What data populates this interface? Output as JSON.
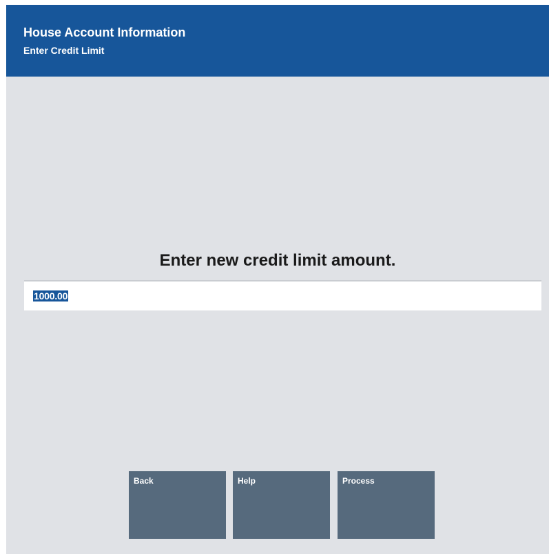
{
  "header": {
    "title": "House Account Information",
    "subtitle": "Enter Credit Limit"
  },
  "prompt": "Enter new credit limit amount.",
  "credit_limit_input": {
    "value": "1000.00"
  },
  "buttons": {
    "back": "Back",
    "help": "Help",
    "process": "Process"
  },
  "colors": {
    "header_background": "#17569a",
    "page_background": "#e0e2e6",
    "button_background": "#566a7d",
    "selection_highlight": "#17569a"
  }
}
